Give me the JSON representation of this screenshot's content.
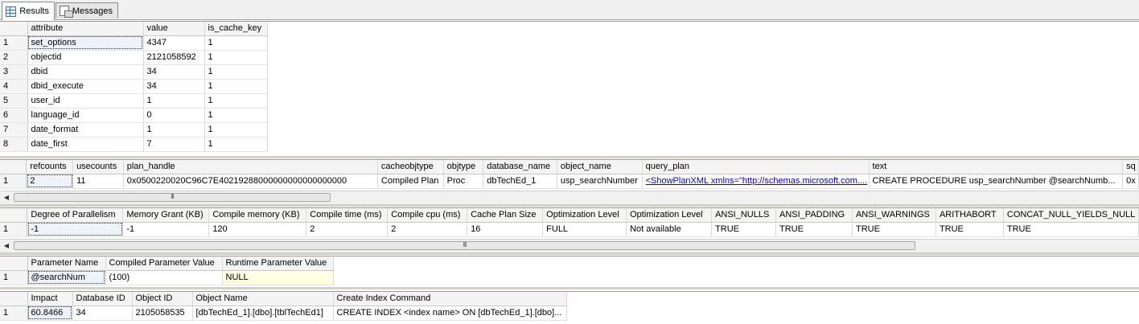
{
  "tabs": [
    {
      "label": "Results",
      "icon": "grid-icon"
    },
    {
      "label": "Messages",
      "icon": "messages-icon"
    }
  ],
  "grid1": {
    "columns": [
      "attribute",
      "value",
      "is_cache_key"
    ],
    "rows": [
      [
        "1",
        "set_options",
        "4347",
        "1"
      ],
      [
        "2",
        "objectid",
        "2121058592",
        "1"
      ],
      [
        "3",
        "dbid",
        "34",
        "1"
      ],
      [
        "4",
        "dbid_execute",
        "34",
        "1"
      ],
      [
        "5",
        "user_id",
        "1",
        "1"
      ],
      [
        "6",
        "language_id",
        "0",
        "1"
      ],
      [
        "7",
        "date_format",
        "1",
        "1"
      ],
      [
        "8",
        "date_first",
        "7",
        "1"
      ]
    ]
  },
  "grid2": {
    "columns": [
      "refcounts",
      "usecounts",
      "plan_handle",
      "cacheobjtype",
      "objtype",
      "database_name",
      "object_name",
      "query_plan",
      "text",
      "sq"
    ],
    "row": [
      "1",
      "2",
      "11",
      "0x0500220020C96C7E40219288000000000000000000",
      "Compiled Plan",
      "Proc",
      "dbTechEd_1",
      "usp_searchNumber",
      "<ShowPlanXML xmlns=\"http://schemas.microsoft.com....",
      "CREATE PROCEDURE usp_searchNumber  @searchNumb...",
      "0x"
    ]
  },
  "grid3": {
    "columns": [
      "Degree of Parallelism",
      "Memory Grant (KB)",
      "Compile memory (KB)",
      "Compile time (ms)",
      "Compile cpu (ms)",
      "Cache Plan Size",
      "Optimization Level",
      "Optimization Level",
      "ANSI_NULLS",
      "ANSI_PADDING",
      "ANSI_WARNINGS",
      "ARITHABORT",
      "CONCAT_NULL_YIELDS_NULL"
    ],
    "row": [
      "1",
      "-1",
      "-1",
      "120",
      "2",
      "2",
      "16",
      "FULL",
      "Not available",
      "TRUE",
      "TRUE",
      "TRUE",
      "TRUE",
      "TRUE"
    ]
  },
  "grid4": {
    "columns": [
      "Parameter Name",
      "Compiled Parameter Value",
      "Runtime Parameter Value"
    ],
    "row": [
      "1",
      "@searchNum",
      "(100)",
      "NULL"
    ]
  },
  "grid5": {
    "columns": [
      "Impact",
      "Database ID",
      "Object ID",
      "Object Name",
      "Create Index Command"
    ],
    "row": [
      "1",
      "60.8466",
      "34",
      "2105058535",
      "[dbTechEd_1].[dbo].[tblTechEd1]",
      "CREATE INDEX <index name> ON [dbTechEd_1].[dbo]..."
    ]
  },
  "scrollbar": {
    "thumb_grip": "III"
  }
}
